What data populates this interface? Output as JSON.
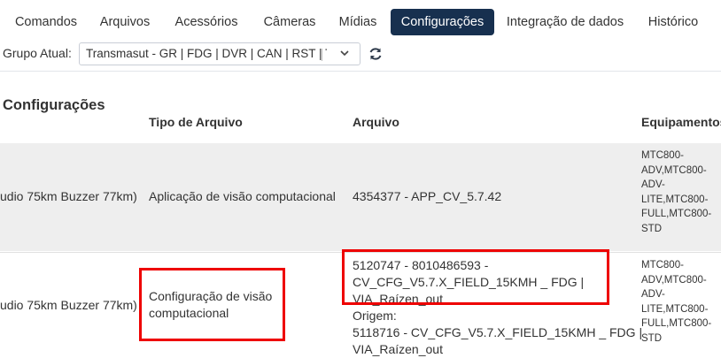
{
  "tabs": [
    {
      "label": "Comandos"
    },
    {
      "label": "Arquivos"
    },
    {
      "label": "Acessórios"
    },
    {
      "label": "Câmeras"
    },
    {
      "label": "Mídias"
    },
    {
      "label": "Configurações",
      "active": true
    },
    {
      "label": "Integração de dados"
    },
    {
      "label": "Histórico"
    }
  ],
  "group": {
    "label": "Grupo Atual:",
    "value": "Transmasut - GR | FDG | DVR | CAN | RST | T",
    "dropdown_icon": "chevron-down-icon",
    "refresh_icon": "refresh-icon"
  },
  "section": {
    "title": "Configurações"
  },
  "table": {
    "headers": {
      "tipo": "Tipo de Arquivo",
      "arquivo": "Arquivo",
      "equipamentos": "Equipamentos"
    },
    "rows": [
      {
        "name_partial": "udio 75km Buzzer 77km)",
        "tipo": "Aplicação de visão computacional",
        "arquivo": "4354377 - APP_CV_5.7.42",
        "equipamentos": [
          "MTC800-",
          "ADV,MTC800-",
          "ADV-",
          "LITE,MTC800-",
          "FULL,MTC800-",
          "STD"
        ]
      },
      {
        "name_partial": "udio 75km Buzzer 77km)",
        "tipo": [
          "Configuração de visão",
          "computacional"
        ],
        "arquivo": [
          "5120747 - 8010486593 -",
          "CV_CFG_V5.7.X_FIELD_15KMH _ FDG |",
          "VIA_Raízen_out"
        ],
        "origem_label": "Origem:",
        "origem": [
          "5118716 - CV_CFG_V5.7.X_FIELD_15KMH _ FDG |",
          "VIA_Raízen_out"
        ],
        "equipamentos": [
          "MTC800-",
          "ADV,MTC800-",
          "ADV-",
          "LITE,MTC800-",
          "FULL,MTC800-",
          "STD"
        ]
      }
    ]
  },
  "colors": {
    "active_tab_bg": "#17304f",
    "highlight": "#ee0000",
    "row_alt": "#eeeeee"
  }
}
